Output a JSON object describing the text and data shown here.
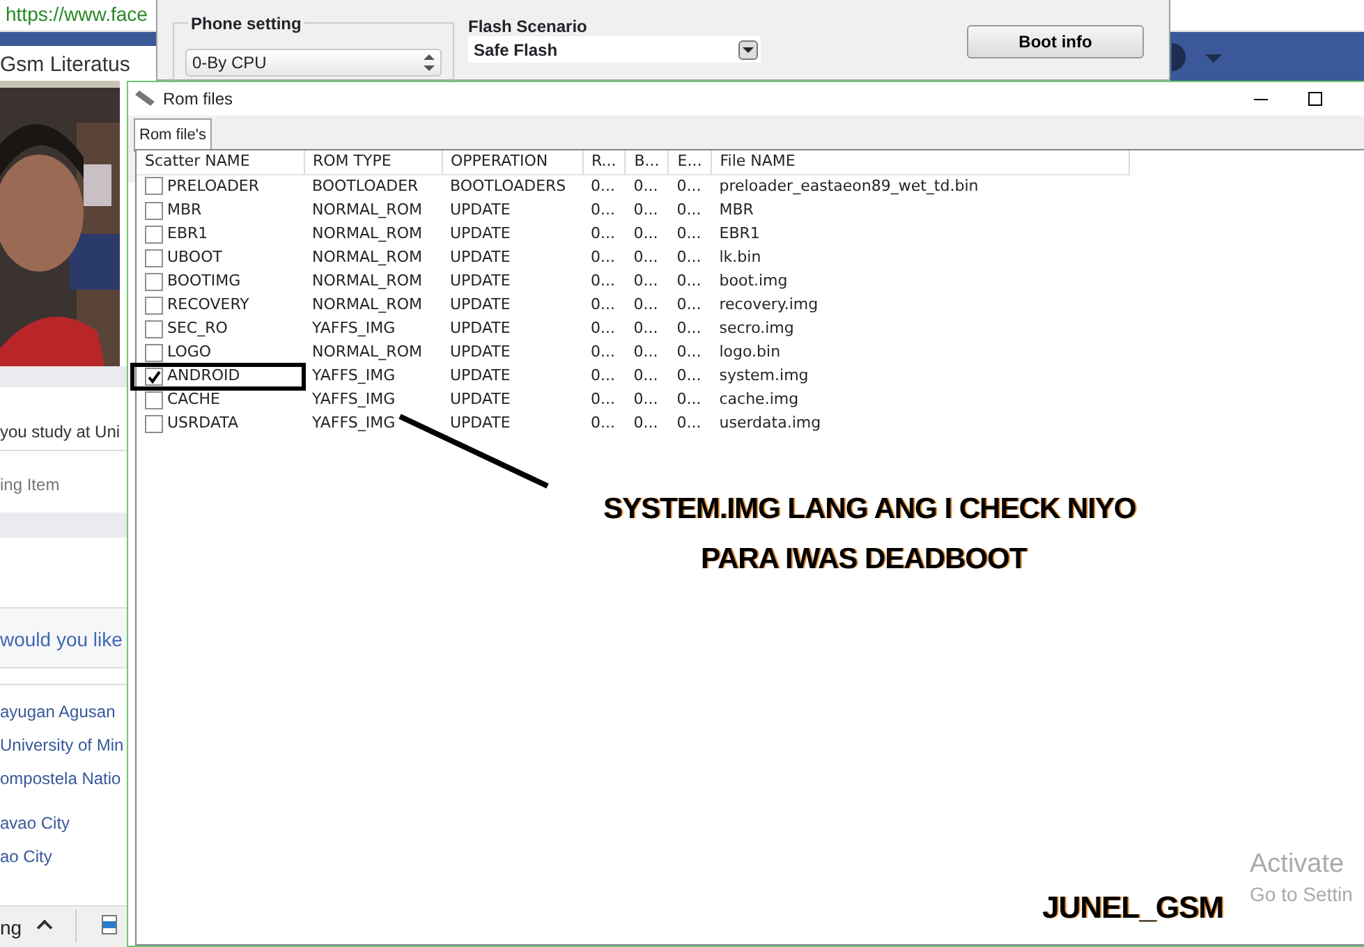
{
  "browser": {
    "address": "https://www.face",
    "profile_name": "Gsm Literatus",
    "study_prompt": "you study at Uni",
    "pending_item": "ing Item",
    "question": "would you like",
    "schools": [
      "ayugan Agusan",
      "University of Min",
      "ompostela Natio"
    ],
    "places": [
      "avao City",
      "ao City"
    ],
    "taskbar_text": "ng"
  },
  "tool_window": {
    "phone_setting": {
      "title": "Phone setting",
      "value": "0-By CPU"
    },
    "flash_scenario": {
      "label": "Flash Scenario",
      "value": "Safe Flash"
    },
    "buttons": [
      "Boot info"
    ]
  },
  "rom_window": {
    "title": "Rom files",
    "tabs": [
      {
        "label": "Rom file's",
        "selected": true
      }
    ],
    "columns": [
      "Scatter NAME",
      "ROM TYPE",
      "OPPERATION",
      "R...",
      "B...",
      "E...",
      "File NAME"
    ],
    "rows": [
      {
        "scatter_name": "PRELOADER",
        "rom_type": "BOOTLOADER",
        "operation": "BOOTLOADERS",
        "r": "0...",
        "b": "0...",
        "e": "0...",
        "file_name": "preloader_eastaeon89_wet_td.bin",
        "checked": false
      },
      {
        "scatter_name": "MBR",
        "rom_type": "NORMAL_ROM",
        "operation": "UPDATE",
        "r": "0...",
        "b": "0...",
        "e": "0...",
        "file_name": "MBR",
        "checked": false
      },
      {
        "scatter_name": "EBR1",
        "rom_type": "NORMAL_ROM",
        "operation": "UPDATE",
        "r": "0...",
        "b": "0...",
        "e": "0...",
        "file_name": "EBR1",
        "checked": false
      },
      {
        "scatter_name": "UBOOT",
        "rom_type": "NORMAL_ROM",
        "operation": "UPDATE",
        "r": "0...",
        "b": "0...",
        "e": "0...",
        "file_name": "lk.bin",
        "checked": false
      },
      {
        "scatter_name": "BOOTIMG",
        "rom_type": "NORMAL_ROM",
        "operation": "UPDATE",
        "r": "0...",
        "b": "0...",
        "e": "0...",
        "file_name": "boot.img",
        "checked": false
      },
      {
        "scatter_name": "RECOVERY",
        "rom_type": "NORMAL_ROM",
        "operation": "UPDATE",
        "r": "0...",
        "b": "0...",
        "e": "0...",
        "file_name": "recovery.img",
        "checked": false
      },
      {
        "scatter_name": "SEC_RO",
        "rom_type": "YAFFS_IMG",
        "operation": "UPDATE",
        "r": "0...",
        "b": "0...",
        "e": "0...",
        "file_name": "secro.img",
        "checked": false
      },
      {
        "scatter_name": "LOGO",
        "rom_type": "NORMAL_ROM",
        "operation": "UPDATE",
        "r": "0...",
        "b": "0...",
        "e": "0...",
        "file_name": "logo.bin",
        "checked": false
      },
      {
        "scatter_name": "ANDROID",
        "rom_type": "YAFFS_IMG",
        "operation": "UPDATE",
        "r": "0...",
        "b": "0...",
        "e": "0...",
        "file_name": "system.img",
        "checked": true
      },
      {
        "scatter_name": "CACHE",
        "rom_type": "YAFFS_IMG",
        "operation": "UPDATE",
        "r": "0...",
        "b": "0...",
        "e": "0...",
        "file_name": "cache.img",
        "checked": false
      },
      {
        "scatter_name": "USRDATA",
        "rom_type": "YAFFS_IMG",
        "operation": "UPDATE",
        "r": "0...",
        "b": "0...",
        "e": "0...",
        "file_name": "userdata.img",
        "checked": false
      }
    ]
  },
  "annotation": {
    "lines": [
      "SYSTEM.IMG LANG ANG I CHECK NIYO",
      "PARA IWAS DEADBOOT"
    ],
    "signature": "JUNEL_GSM"
  },
  "os_notice": [
    "Activate",
    "Go to Settin"
  ]
}
